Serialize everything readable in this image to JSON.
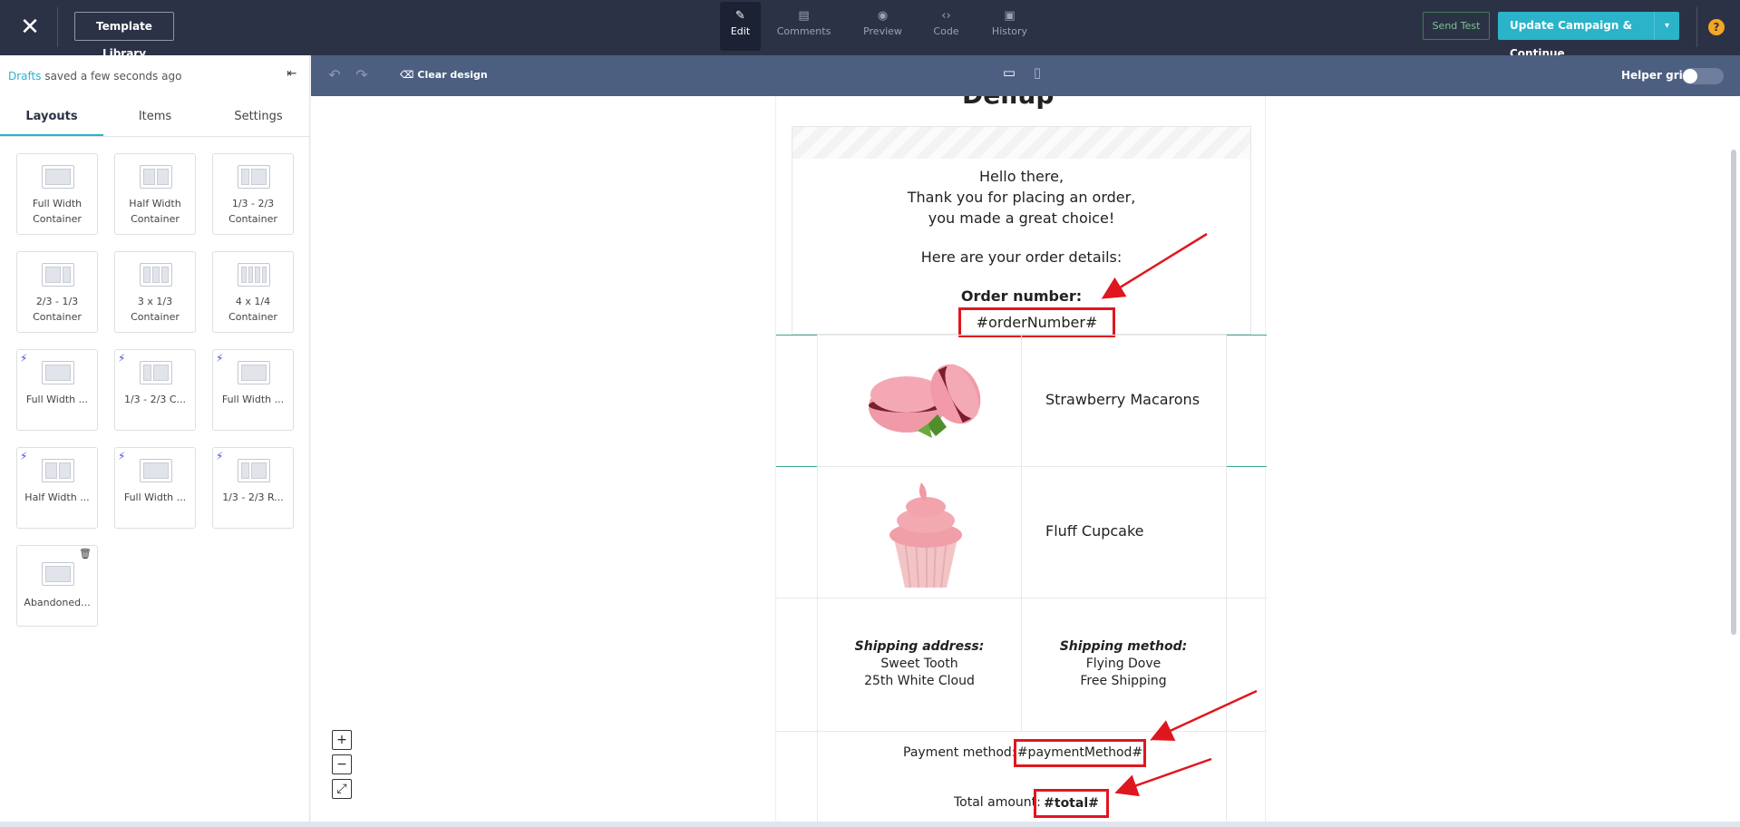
{
  "topbar": {
    "template_library": "Template Library",
    "tabs": [
      {
        "label": "Edit",
        "icon": "pencil-icon"
      },
      {
        "label": "Comments",
        "icon": "comments-icon"
      },
      {
        "label": "Preview",
        "icon": "eye-icon"
      },
      {
        "label": "Code",
        "icon": "code-icon"
      },
      {
        "label": "History",
        "icon": "inbox-icon"
      }
    ],
    "send_test": "Send Test",
    "update": "Update Campaign & Continue",
    "help": "?"
  },
  "left_panel": {
    "status_link": "Drafts",
    "status_text": " saved a few seconds ago",
    "tabs": [
      "Layouts",
      "Items",
      "Settings"
    ],
    "cards": [
      {
        "name": "Full Width Container"
      },
      {
        "name": "Half Width Container"
      },
      {
        "name": "1/3 - 2/3 Container"
      },
      {
        "name": "2/3 - 1/3 Container"
      },
      {
        "name": "3 x 1/3 Container"
      },
      {
        "name": "4 x 1/4 Container"
      },
      {
        "name": "Full Width ..."
      },
      {
        "name": "1/3 - 2/3 C..."
      },
      {
        "name": "Full Width ..."
      },
      {
        "name": "Half Width ..."
      },
      {
        "name": "Full Width ..."
      },
      {
        "name": "1/3 - 2/3 R..."
      },
      {
        "name": "Abandoned..."
      }
    ]
  },
  "canvas_toolbar": {
    "clear": "Clear design",
    "helper_grid": "Helper grid"
  },
  "email": {
    "heading_fragment": "Deliup",
    "greeting": "Hello there,",
    "thanks": "Thank you for placing an order,",
    "choice": "you made a great choice!",
    "details": "Here are your order details:",
    "order_label": "Order number:",
    "order_value": "#orderNumber#",
    "items": [
      {
        "name": "Strawberry Macarons"
      },
      {
        "name": "Fluff Cupcake"
      }
    ],
    "shipping_address_label": "Shipping address:",
    "shipping_address_line1": "Sweet Tooth",
    "shipping_address_line2": "25th White Cloud",
    "shipping_method_label": "Shipping method:",
    "shipping_method_line1": "Flying Dove",
    "shipping_method_line2": "Free Shipping",
    "payment_label": "Payment method:",
    "payment_value": "#paymentMethod#",
    "total_label": "Total amount:",
    "total_value": "#total#"
  },
  "zoom": {
    "plus": "+",
    "minus": "−",
    "fit": "⤢"
  },
  "colors": {
    "topbar": "#2c3246",
    "accent": "#2ab3c9",
    "toolbar": "#4d5f80",
    "highlight_red": "#e0161f"
  }
}
